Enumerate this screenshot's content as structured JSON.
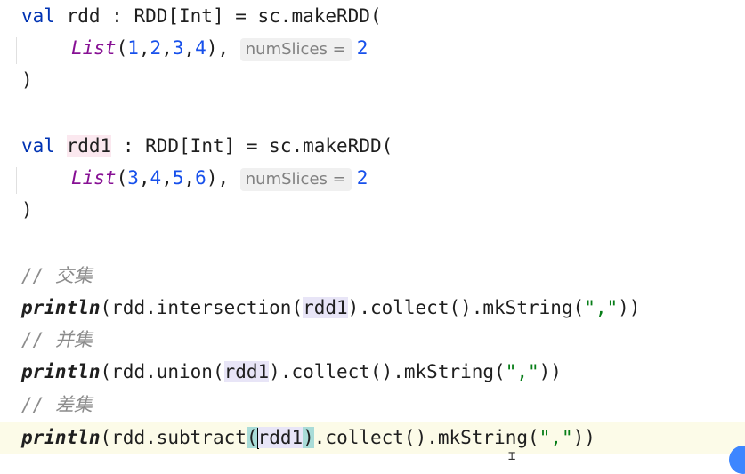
{
  "code": {
    "l1": {
      "kw": "val",
      "name": " rdd : RDD[Int] = sc.makeRDD("
    },
    "l2": {
      "fn": "List",
      "open": "(",
      "n1": "1",
      "c1": ",",
      "n2": "2",
      "c2": ",",
      "n3": "3",
      "c3": ",",
      "n4": "4",
      "close": "), ",
      "hint": "numSlices =",
      "arg": "2"
    },
    "l3": {
      "text": ")"
    },
    "l4": {
      "kw": "val",
      "name": "rdd1",
      "rest": " : RDD[Int] = sc.makeRDD("
    },
    "l5": {
      "fn": "List",
      "open": "(",
      "n1": "3",
      "c1": ",",
      "n2": "4",
      "c2": ",",
      "n3": "5",
      "c3": ",",
      "n4": "6",
      "close": "), ",
      "hint": "numSlices =",
      "arg": "2"
    },
    "l6": {
      "text": ")"
    },
    "comment1": "// 交集",
    "l7": {
      "fn": "println",
      "pre": "(rdd.intersection(",
      "ref": "rdd1",
      "post": ").collect().mkString(",
      "str": "\",\"",
      "end": "))"
    },
    "comment2": "// 并集",
    "l8": {
      "fn": "println",
      "pre": "(rdd.union(",
      "ref": "rdd1",
      "post": ").collect().mkString(",
      "str": "\",\"",
      "end": "))"
    },
    "comment3": "// 差集",
    "l9": {
      "fn": "println",
      "pre": "(rdd.subtract",
      "brace_open": "(",
      "ref": "rdd1",
      "brace_close": ")",
      "post": ".collect().mkString(",
      "str": "\",\"",
      "end": "))"
    }
  },
  "colors": {
    "keyword": "#0033b3",
    "number": "#1750eb",
    "string": "#067d17",
    "comment": "#8c8c8c",
    "current_line": "#fcfbe8"
  }
}
